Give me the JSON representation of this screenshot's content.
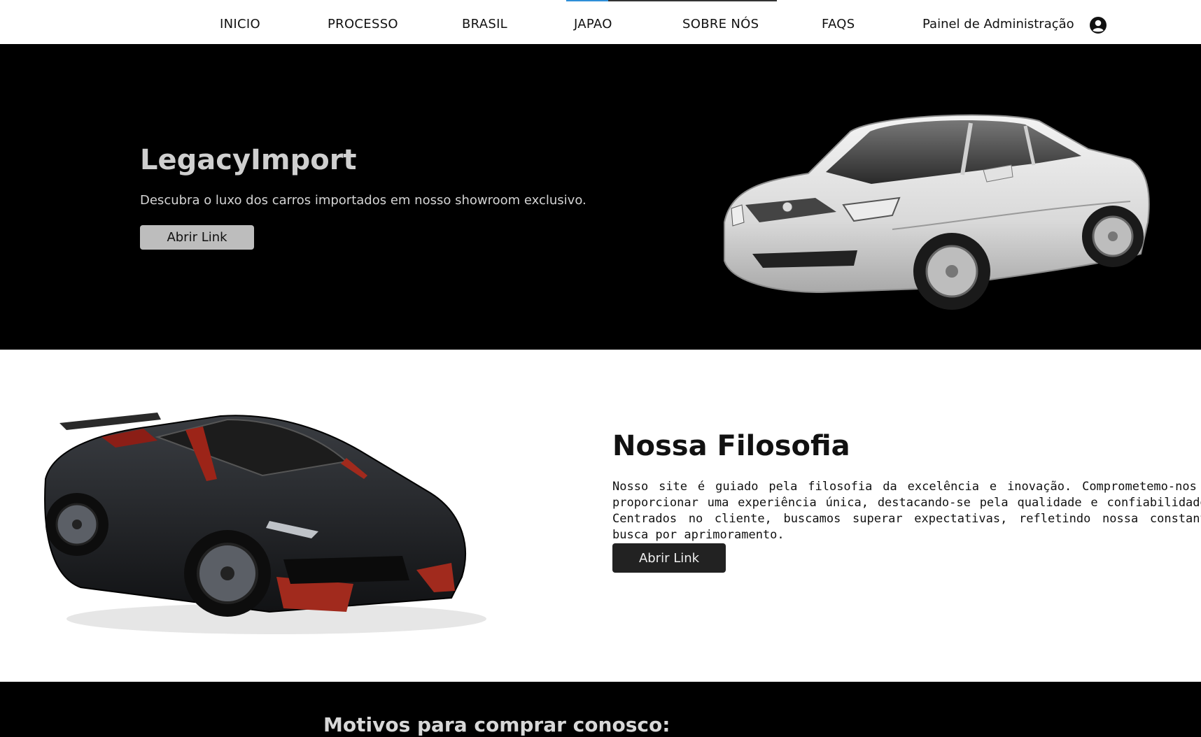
{
  "nav": {
    "items": [
      {
        "label": "INICIO"
      },
      {
        "label": "PROCESSO"
      },
      {
        "label": "BRASIL"
      },
      {
        "label": "JAPAO"
      },
      {
        "label": "SOBRE NÓS"
      },
      {
        "label": "FAQS"
      }
    ],
    "admin_label": "Painel de Administração",
    "user_icon": "user-circle-icon"
  },
  "hero": {
    "title": "LegacyImport",
    "subtitle": "Descubra o luxo dos carros importados em nosso showroom exclusivo.",
    "button_label": "Abrir Link",
    "image": "white-sedan-car"
  },
  "philosophy": {
    "title": "Nossa Filosofia",
    "text": "Nosso site é guiado pela filosofia da excelência e inovação. Comprometemo-nos a proporcionar uma experiência única, destacando-se pela qualidade e confiabilidade. Centrados no cliente, buscamos superar expectativas, refletindo nossa constante busca por aprimoramento.",
    "button_label": "Abrir Link",
    "image": "black-sports-car"
  },
  "reasons": {
    "title": "Motivos para comprar conosco:"
  },
  "colors": {
    "hero_bg": "#000000",
    "accent_indicator": "#2f8fd8",
    "dark_button": "#222222",
    "light_button": "#bdbdbd"
  }
}
